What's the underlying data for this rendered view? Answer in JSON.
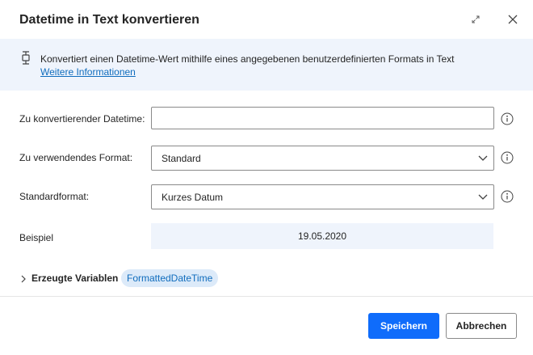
{
  "dialog": {
    "title": "Datetime in Text konvertieren",
    "icons": {
      "expand": "expand-icon",
      "close": "close-icon"
    }
  },
  "banner": {
    "icon": "variable-icon",
    "description": "Konvertiert einen Datetime-Wert mithilfe eines angegebenen benutzerdefinierten Formats in Text",
    "link_text": "Weitere Informationen"
  },
  "fields": {
    "datetime": {
      "label": "Zu konvertierender Datetime:",
      "value": "",
      "placeholder": ""
    },
    "format": {
      "label": "Zu verwendendes Format:",
      "selected": "Standard"
    },
    "standard_format": {
      "label": "Standardformat:",
      "selected": "Kurzes Datum"
    },
    "example": {
      "label": "Beispiel",
      "value": "19.05.2020"
    }
  },
  "variables": {
    "label": "Erzeugte Variablen",
    "items": [
      "FormattedDateTime"
    ]
  },
  "footer": {
    "save_label": "Speichern",
    "cancel_label": "Abbrechen"
  },
  "colors": {
    "primary": "#0f6cfb",
    "link": "#0f6cbd",
    "banner_bg": "#eff4fc"
  }
}
